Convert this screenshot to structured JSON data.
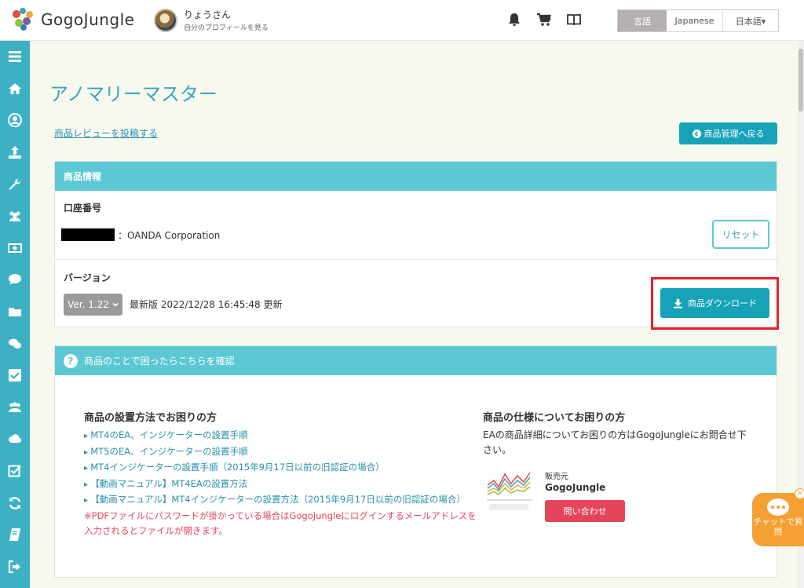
{
  "header": {
    "logo_text": "GogoJungle",
    "profile_name": "りょうさん",
    "profile_sub": "自分のプロフィールを見る",
    "lang_label": "言語",
    "lang_current": "Japanese",
    "lang_select": "日本語▾",
    "icons": [
      "bell-icon",
      "cart-icon",
      "book-icon"
    ]
  },
  "sidebar": {
    "items": [
      "menu-icon",
      "home-icon",
      "user-icon",
      "upload-icon",
      "wrench-icon",
      "users-icon",
      "money-icon",
      "comment-icon",
      "folder-icon",
      "comments-icon",
      "check-icon",
      "group-icon",
      "cloud-icon",
      "checkbox-icon",
      "refresh-icon",
      "notebook-icon",
      "logout-icon"
    ]
  },
  "page": {
    "title": "アノマリーマスター",
    "review_link": "商品レビューを投稿する",
    "back_button": "商品管理へ戻る"
  },
  "product_info": {
    "heading": "商品情報",
    "account_label": "口座番号",
    "account_value": "：OANDA Corporation",
    "reset_button": "リセット",
    "version_label": "バージョン",
    "version_select": "Ver. 1.22",
    "version_info": "最新版 2022/12/28 16:45:48 更新",
    "download_button": "商品ダウンロード"
  },
  "help": {
    "heading": "商品のことで困ったらこちらを確認",
    "setup_title": "商品の設置方法でお困りの方",
    "links": [
      "MT4のEA、インジケーターの設置手順",
      "MT5のEA、インジケーターの設置手順",
      "MT4インジケーターの設置手順（2015年9月17日以前の旧認証の場合）",
      "【動画マニュアル】MT4EAの設置方法",
      "【動画マニュアル】MT4インジケーターの設置方法（2015年9月17日以前の旧認証の場合）"
    ],
    "warning": "※PDFファイルにパスワードが掛かっている場合はGogoJungleにログインするメールアドレスを入力されるとファイルが開きます。",
    "spec_title": "商品の仕様についてお困りの方",
    "spec_desc": "EAの商品詳細についてお困りの方はGogoJungleにお問合せ下さい。",
    "seller_label": "販売元",
    "seller_name": "GogoJungle",
    "contact_button": "問い合わせ"
  },
  "chat": {
    "label": "チャットで質問"
  },
  "colors": {
    "accent": "#17a2b8",
    "panel_header": "#5cc8d3",
    "sidebar": "#3db1c3",
    "highlight": "#e8212d",
    "contact": "#e4455a",
    "chat": "#f5a033"
  }
}
